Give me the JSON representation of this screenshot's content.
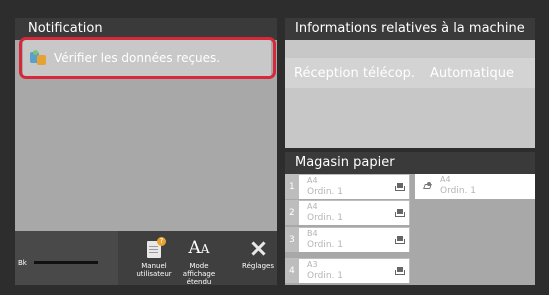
{
  "notification": {
    "title": "Notification",
    "message": "Vérifier les données reçues.",
    "message_icon": "received-data-icon",
    "highlight_color": "#d6283b"
  },
  "toolbar": {
    "toner_label": "Bk",
    "manual_label": "Manuel utilisateur",
    "manual_icon": "user-manual-icon",
    "mode_icon_text": "A",
    "mode_icon_small": "A",
    "mode_label": "Mode affichage étendu",
    "settings_label": "Réglages",
    "settings_icon": "wrench-screwdriver-icon"
  },
  "machine_info": {
    "title": "Informations relatives à la machine",
    "fax_reception_label": "Réception télécop.",
    "fax_reception_value": "Automatique"
  },
  "paper_tray": {
    "title": "Magasin papier",
    "trays": [
      {
        "number": "1",
        "size": "A4",
        "type": "Ordin. 1"
      },
      {
        "number": "2",
        "size": "A4",
        "type": "Ordin. 1"
      },
      {
        "number": "3",
        "size": "B4",
        "type": "Ordin. 1"
      },
      {
        "number": "4",
        "size": "A3",
        "type": "Ordin. 1"
      }
    ],
    "bypass": {
      "size": "A4",
      "type": "Ordin. 1"
    }
  }
}
